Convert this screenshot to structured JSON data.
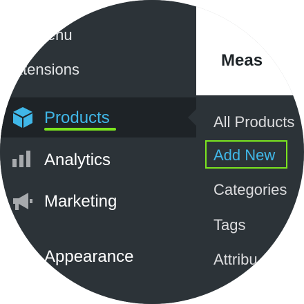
{
  "sidebar": {
    "items": [
      {
        "label": "Menu",
        "visible": "lenu"
      },
      {
        "label": "Extensions",
        "visible": "xtensions"
      },
      {
        "label": "Products",
        "icon": "box-icon",
        "active": true
      },
      {
        "label": "Analytics",
        "icon": "bar-chart-icon"
      },
      {
        "label": "Marketing",
        "icon": "megaphone-icon"
      },
      {
        "label": "Appearance"
      }
    ]
  },
  "submenu": {
    "items": [
      {
        "label": "All Products"
      },
      {
        "label": "Add New",
        "highlighted": true
      },
      {
        "label": "Categories"
      },
      {
        "label": "Tags"
      },
      {
        "label": "Attributes",
        "visible": "Attribu"
      }
    ]
  },
  "content": {
    "title": "Meas"
  },
  "colors": {
    "sidebar_bg": "#2c3338",
    "active_bg": "#1e2327",
    "accent_blue": "#40b7e8",
    "highlight_green": "#7be51f"
  }
}
